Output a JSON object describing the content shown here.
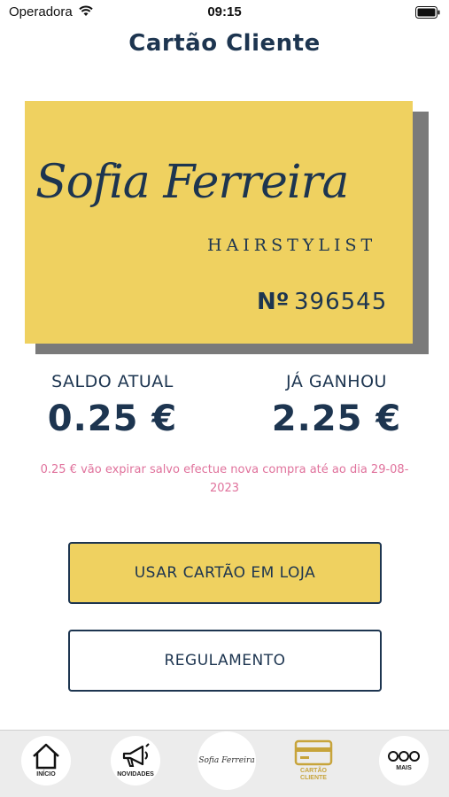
{
  "status": {
    "carrier": "Operadora",
    "time": "09:15"
  },
  "header": {
    "title": "Cartão Cliente"
  },
  "card": {
    "brand_script": "Sofia Ferreira",
    "brand_sub": "HAIRSTYLIST",
    "number_label": "Nº",
    "number": "396545",
    "background_color": "#efd160"
  },
  "balance": {
    "current_label": "SALDO ATUAL",
    "current_value": "0.25 €",
    "earned_label": "JÁ GANHOU",
    "earned_value": "2.25 €"
  },
  "expire_note": "0.25 € vão expirar salvo efectue nova compra até ao dia 29-08-2023",
  "buttons": {
    "use_card": "USAR CARTÃO EM LOJA",
    "rules": "REGULAMENTO"
  },
  "tabs": [
    {
      "label": "INÍCIO",
      "icon": "home-icon"
    },
    {
      "label": "NOVIDADES",
      "icon": "megaphone-icon"
    },
    {
      "label": "",
      "icon": "logo-icon"
    },
    {
      "label": "CARTÃO CLIENTE",
      "icon": "card-icon",
      "active": true
    },
    {
      "label": "MAIS",
      "icon": "more-icon"
    }
  ],
  "colors": {
    "primary": "#1d3550",
    "accent": "#efd160",
    "warning": "#e0729c",
    "active_tab": "#c7a43b"
  }
}
